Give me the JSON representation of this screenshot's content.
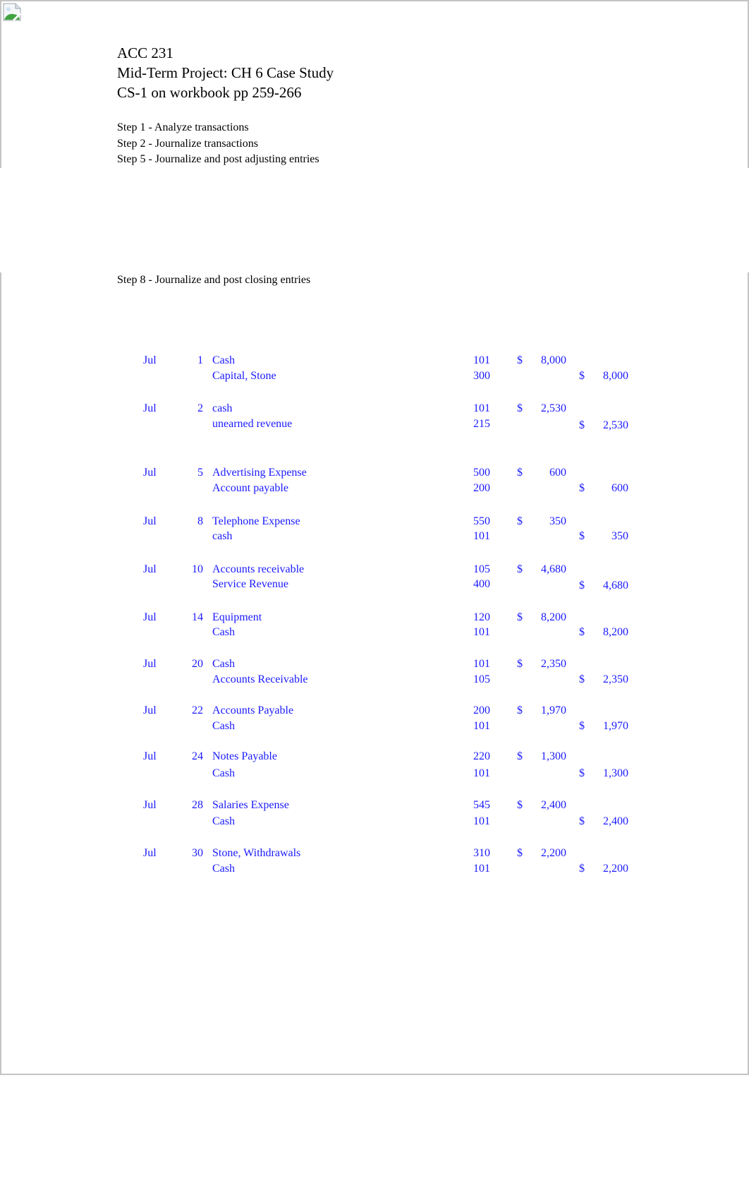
{
  "header": {
    "course": "ACC 231",
    "project": "Mid-Term Project: CH 6 Case Study",
    "reference": "CS-1 on workbook pp 259-266"
  },
  "steps": [
    "Step 1 - Analyze transactions",
    "Step 2 - Journalize transactions",
    "Step 5 - Journalize and post adjusting entries",
    "Step 8 - Journalize and post closing entries"
  ],
  "currency_symbol": "$",
  "colors": {
    "entry_text": "#1a1aff",
    "frame": "#c4c4c4"
  },
  "journal": [
    {
      "month": "Jul",
      "day": "1",
      "debit_account": "Cash",
      "debit_ref": "101",
      "debit_amount": "8,000",
      "credit_account": "Capital, Stone",
      "credit_ref": "300",
      "credit_amount": "8,000"
    },
    {
      "month": "Jul",
      "day": "2",
      "debit_account": "cash",
      "debit_ref": "101",
      "debit_amount": "2,530",
      "credit_account": "unearned revenue",
      "credit_ref": "215",
      "credit_amount": "2,530"
    },
    {
      "month": "Jul",
      "day": "5",
      "debit_account": "Advertising Expense",
      "debit_ref": "500",
      "debit_amount": "600",
      "credit_account": "Account payable",
      "credit_ref": "200",
      "credit_amount": "600"
    },
    {
      "month": "Jul",
      "day": "8",
      "debit_account": "Telephone Expense",
      "debit_ref": "550",
      "debit_amount": "350",
      "credit_account": "cash",
      "credit_ref": "101",
      "credit_amount": "350"
    },
    {
      "month": "Jul",
      "day": "10",
      "debit_account": "Accounts receivable",
      "debit_ref": "105",
      "debit_amount": "4,680",
      "credit_account": "Service Revenue",
      "credit_ref": "400",
      "credit_amount": "4,680"
    },
    {
      "month": "Jul",
      "day": "14",
      "debit_account": "Equipment",
      "debit_ref": "120",
      "debit_amount": "8,200",
      "credit_account": "Cash",
      "credit_ref": "101",
      "credit_amount": "8,200"
    },
    {
      "month": "Jul",
      "day": "20",
      "debit_account": "Cash",
      "debit_ref": "101",
      "debit_amount": "2,350",
      "credit_account": "Accounts Receivable",
      "credit_ref": "105",
      "credit_amount": "2,350"
    },
    {
      "month": "Jul",
      "day": "22",
      "debit_account": "Accounts Payable",
      "debit_ref": "200",
      "debit_amount": "1,970",
      "credit_account": "Cash",
      "credit_ref": "101",
      "credit_amount": "1,970"
    },
    {
      "month": "Jul",
      "day": "24",
      "debit_account": "Notes Payable",
      "debit_ref": "220",
      "debit_amount": "1,300",
      "credit_account": "Cash",
      "credit_ref": "101",
      "credit_amount": "1,300"
    },
    {
      "month": "Jul",
      "day": "28",
      "debit_account": "Salaries Expense",
      "debit_ref": "545",
      "debit_amount": "2,400",
      "credit_account": "Cash",
      "credit_ref": "101",
      "credit_amount": "2,400"
    },
    {
      "month": "Jul",
      "day": "30",
      "debit_account": "Stone, Withdrawals",
      "debit_ref": "310",
      "debit_amount": "2,200",
      "credit_account": "Cash",
      "credit_ref": "101",
      "credit_amount": "2,200"
    }
  ]
}
